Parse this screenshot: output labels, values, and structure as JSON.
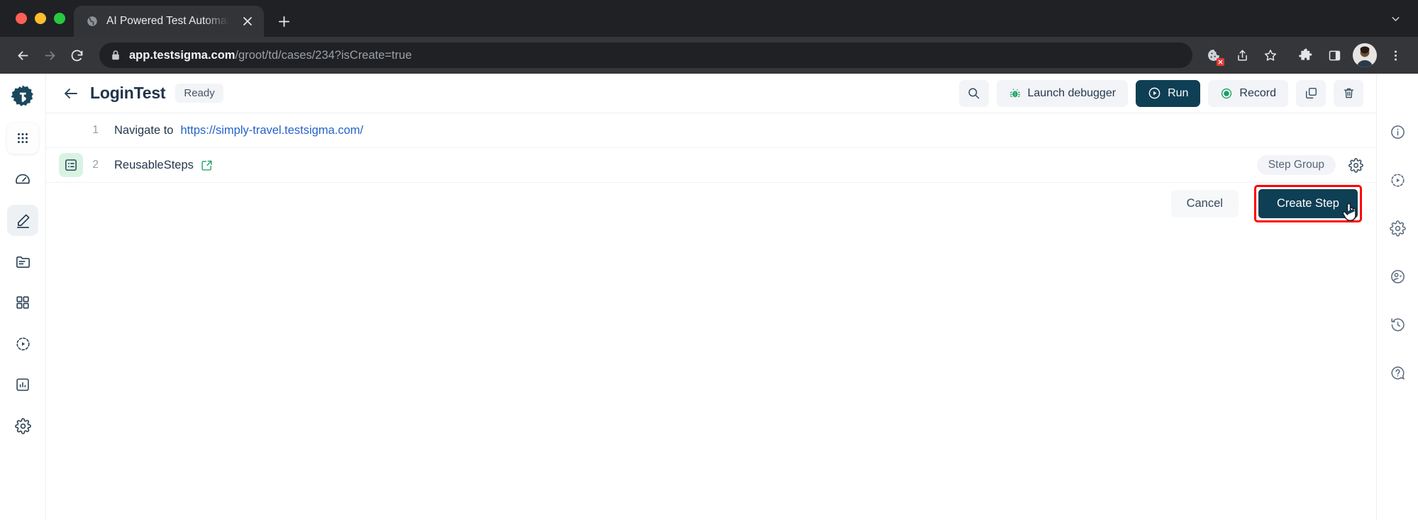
{
  "browser": {
    "tab": {
      "title": "AI Powered Test Automation Pl",
      "favicon_icon": "globe-icon",
      "close_icon": "close-icon"
    },
    "new_tab_icon": "plus-icon",
    "tabstrip_menu_icon": "chevron-down-icon",
    "nav": {
      "back_icon": "back-arrow-icon",
      "forward_icon": "forward-arrow-icon",
      "reload_icon": "reload-icon"
    },
    "omnibox": {
      "lock_icon": "lock-icon",
      "host": "app.testsigma.com",
      "path": "/groot/td/cases/234?isCreate=true",
      "full_url": "app.testsigma.com/groot/td/cases/234?isCreate=true"
    },
    "toolbar_right": [
      {
        "name": "cookie-blocked-icon"
      },
      {
        "name": "share-icon"
      },
      {
        "name": "bookmark-star-icon"
      },
      {
        "name": "extensions-puzzle-icon"
      },
      {
        "name": "side-panel-icon"
      },
      {
        "name": "profile-avatar"
      },
      {
        "name": "three-dot-menu-icon"
      }
    ]
  },
  "sidebar": {
    "logo": "testsigma-logo",
    "items": [
      {
        "name": "apps-grid-icon",
        "state": "boxed"
      },
      {
        "name": "speedometer-icon",
        "state": "default"
      },
      {
        "name": "pencil-edit-icon",
        "state": "active"
      },
      {
        "name": "folder-icon",
        "state": "default"
      },
      {
        "name": "squares-icon",
        "state": "default"
      },
      {
        "name": "play-circle-icon",
        "state": "default"
      },
      {
        "name": "chart-bar-icon",
        "state": "default"
      },
      {
        "name": "settings-gear-icon",
        "state": "default"
      }
    ]
  },
  "header": {
    "back_label": "back",
    "title": "LoginTest",
    "status_badge": "Ready",
    "search_icon": "search-icon",
    "launch_debugger": {
      "label": "Launch debugger",
      "icon": "bug-icon",
      "icon_color": "#16a163"
    },
    "run": {
      "label": "Run",
      "icon": "play-circle-icon",
      "bg": "#0e3f54"
    },
    "record": {
      "label": "Record",
      "icon": "record-circle-icon",
      "icon_color": "#16a163"
    },
    "copy_icon": "copy-icon",
    "delete_icon": "trash-icon"
  },
  "steps": [
    {
      "number": "1",
      "prefix": "Navigate to",
      "link": "https://simply-travel.testsigma.com/",
      "badge_icon": null,
      "tag": null,
      "gear_icon": null
    },
    {
      "number": "2",
      "prefix": "ReusableSteps",
      "link": null,
      "external_link_icon": "external-link-icon",
      "badge_icon": "list-details-icon",
      "tag": "Step Group",
      "gear_icon": "settings-gear-icon"
    }
  ],
  "actions": {
    "cancel_label": "Cancel",
    "create_label": "Create Step",
    "create_highlight_color": "#ff0000",
    "cursor_icon": "hand-pointer-cursor"
  },
  "right_rail": [
    {
      "name": "info-circle-icon"
    },
    {
      "name": "dashed-play-circle-icon"
    },
    {
      "name": "settings-gear-icon"
    },
    {
      "name": "chat-bot-icon"
    },
    {
      "name": "history-clock-icon"
    },
    {
      "name": "help-question-icon"
    }
  ]
}
